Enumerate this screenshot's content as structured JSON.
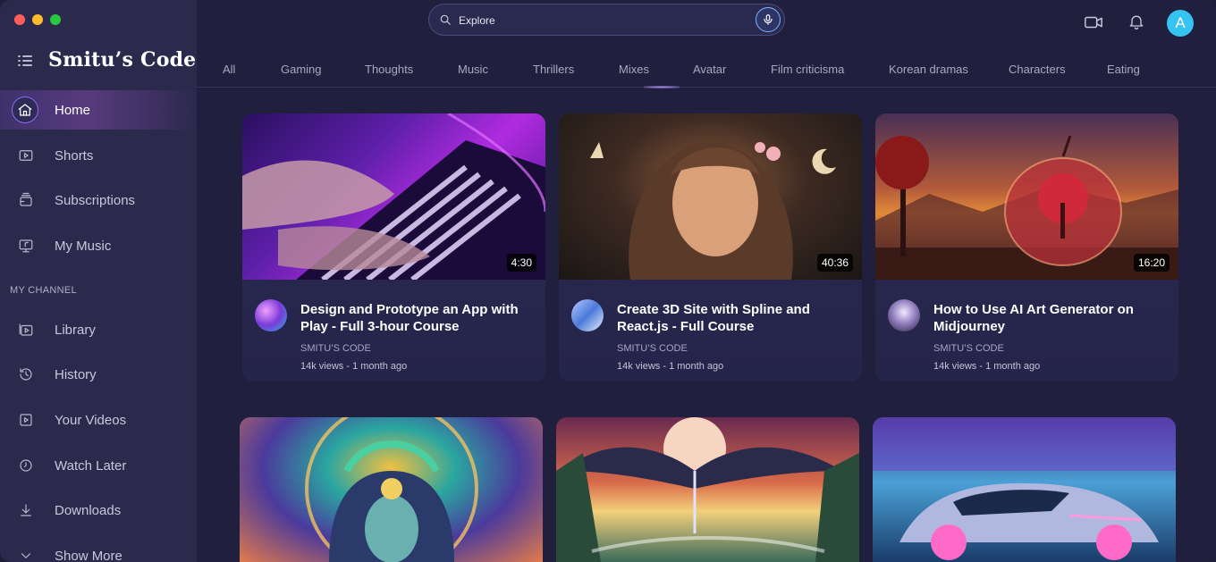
{
  "sidebar": {
    "brand": "Smitu’s Code",
    "nav": [
      {
        "label": "Home",
        "icon": "home-icon",
        "active": true
      },
      {
        "label": "Shorts",
        "icon": "shorts-icon"
      },
      {
        "label": "Subscriptions",
        "icon": "subscriptions-icon"
      },
      {
        "label": "My Music",
        "icon": "music-icon"
      }
    ],
    "section_label": "MY CHANNEL",
    "channel_nav": [
      {
        "label": "Library",
        "icon": "library-icon"
      },
      {
        "label": "History",
        "icon": "history-icon"
      },
      {
        "label": "Your Videos",
        "icon": "your-videos-icon"
      },
      {
        "label": "Watch Later",
        "icon": "clock-icon"
      },
      {
        "label": "Downloads",
        "icon": "download-icon"
      },
      {
        "label": "Show More",
        "icon": "chevron-down-icon"
      }
    ]
  },
  "topbar": {
    "search_text": "Explore",
    "avatar_letter": "A"
  },
  "categories": [
    "All",
    "Gaming",
    "Thoughts",
    "Music",
    "Thrillers",
    "Mixes",
    "Avatar",
    "Film criticisma",
    "Korean dramas",
    "Characters",
    "Eating"
  ],
  "videos": [
    {
      "title": "Design and Prototype an App with Play - Full 3-hour Course",
      "channel": "SMITU’S CODE",
      "meta": "14k views - 1 month ago",
      "duration": "4:30"
    },
    {
      "title": "Create 3D Site with Spline and React.js - Full Course",
      "channel": "SMITU’S CODE",
      "meta": "14k views - 1 month ago",
      "duration": "40:36"
    },
    {
      "title": "How to Use AI Art Generator on Midjourney",
      "channel": "SMITU’S CODE",
      "meta": "14k views - 1 month ago",
      "duration": "16:20"
    }
  ],
  "colors": {
    "background": "#201f3d",
    "sidebar": "#2b2a4c",
    "accent": "#8d6cf0",
    "avatar": "#35c4f0"
  }
}
